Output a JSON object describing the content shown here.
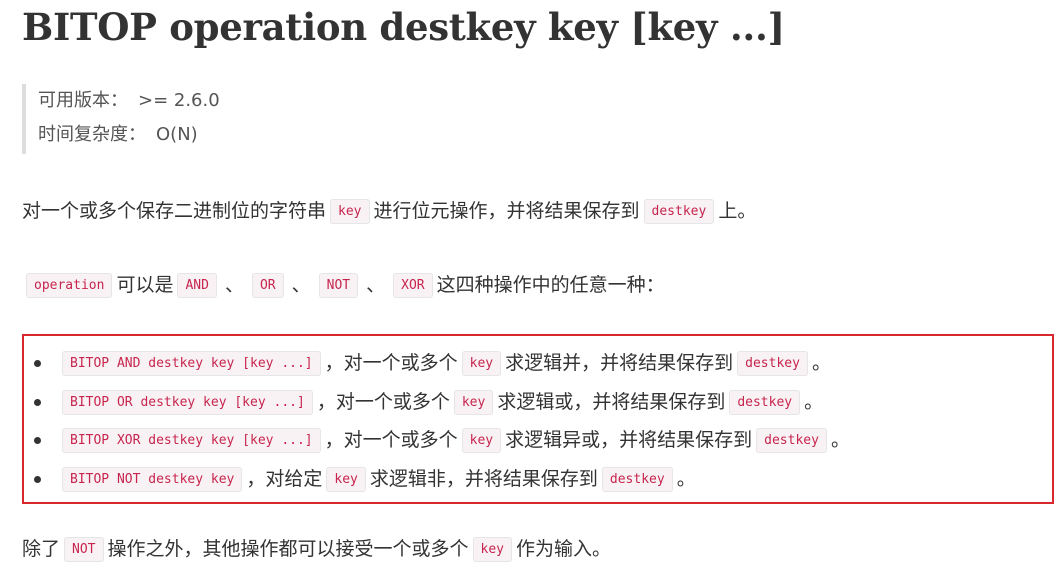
{
  "title": "BITOP operation destkey key [key ...]",
  "meta": {
    "version_label": "可用版本：",
    "version_value": ">= 2.6.0",
    "complexity_label": "时间复杂度：",
    "complexity_value": "O(N)"
  },
  "para1": {
    "text1": "对一个或多个保存二进制位的字符串",
    "code1": "key",
    "text2": "进行位元操作，并将结果保存到",
    "code2": "destkey",
    "text3": "上。"
  },
  "para2": {
    "code_operation": "operation",
    "text1": "可以是",
    "code_and": "AND",
    "sep1": "、",
    "code_or": "OR",
    "sep2": "、",
    "code_not": "NOT",
    "sep3": "、",
    "code_xor": "XOR",
    "text2": "这四种操作中的任意一种："
  },
  "ops": [
    {
      "cmd": "BITOP AND destkey key [key ...]",
      "text1": "，对一个或多个",
      "key": "key",
      "text2": "求逻辑并，并将结果保存到",
      "dest": "destkey",
      "end": "。"
    },
    {
      "cmd": "BITOP OR destkey key [key ...]",
      "text1": "，对一个或多个",
      "key": "key",
      "text2": "求逻辑或，并将结果保存到",
      "dest": "destkey",
      "end": "。"
    },
    {
      "cmd": "BITOP XOR destkey key [key ...]",
      "text1": "，对一个或多个",
      "key": "key",
      "text2": "求逻辑异或，并将结果保存到",
      "dest": "destkey",
      "end": "。"
    },
    {
      "cmd": "BITOP NOT destkey key",
      "text1": "，对给定",
      "key": "key",
      "text2": "求逻辑非，并将结果保存到",
      "dest": "destkey",
      "end": "。"
    }
  ],
  "para3": {
    "text1": "除了",
    "code_not": "NOT",
    "text2": "操作之外，其他操作都可以接受一个或多个",
    "code_key": "key",
    "text3": "作为输入。"
  },
  "colors": {
    "code_text": "#c7254e",
    "code_bg": "#f9f2f4",
    "highlight_border": "#d9272e",
    "text": "#333333"
  }
}
